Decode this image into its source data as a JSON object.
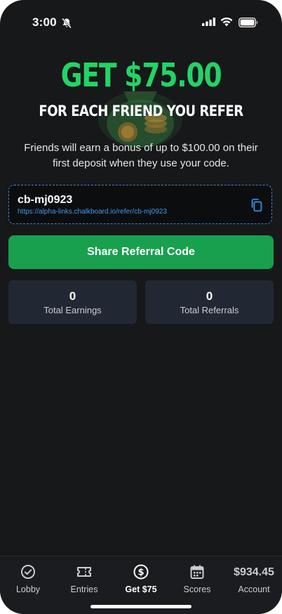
{
  "status_bar": {
    "time": "3:00",
    "icons": [
      "bell-muted-icon",
      "cellular-signal-icon",
      "wifi-icon",
      "battery-icon"
    ]
  },
  "hero": {
    "headline": "GET $75.00",
    "subheadline": "FOR EACH FRIEND YOU REFER",
    "description": "Friends will earn a bonus of up to $100.00 on their first deposit when they use your code.",
    "accent_color": "#22d466"
  },
  "referral": {
    "code": "cb-mj0923",
    "url": "https://alpha-links.chalkboard.io/refer/cb-mj0923",
    "copy_icon": "copy-icon"
  },
  "share_button": {
    "label": "Share Referral Code",
    "color": "#18a04f"
  },
  "stats": [
    {
      "value": "0",
      "label": "Total Earnings"
    },
    {
      "value": "0",
      "label": "Total Referrals"
    }
  ],
  "tabbar": {
    "items": [
      {
        "label": "Lobby",
        "icon": "check-circle-icon"
      },
      {
        "label": "Entries",
        "icon": "ticket-icon"
      },
      {
        "label": "Get $75",
        "icon": "dollar-circle-icon",
        "active": true
      },
      {
        "label": "Scores",
        "icon": "calendar-icon"
      },
      {
        "label": "Account",
        "balance": "$934.45"
      }
    ]
  }
}
